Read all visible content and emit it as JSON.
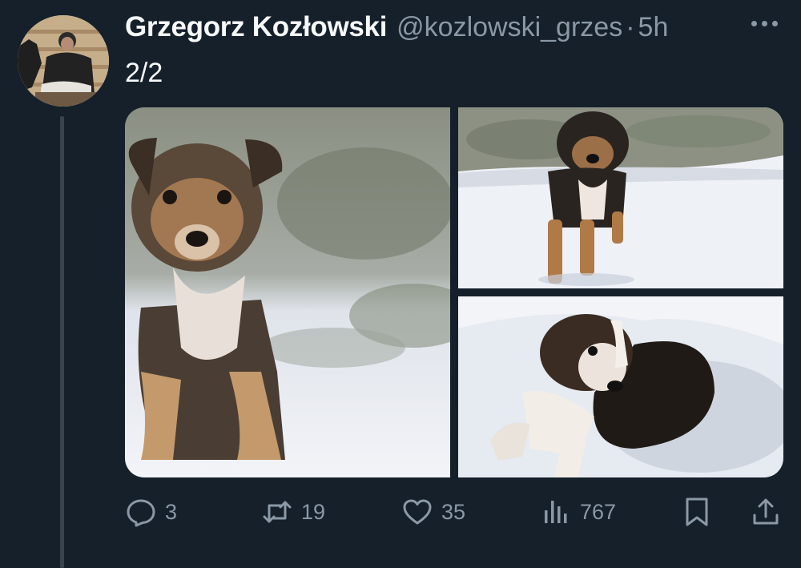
{
  "author": {
    "display_name": "Grzegorz Kozłowski",
    "handle": "@kozlowski_grzes",
    "separator": "·",
    "time": "5h"
  },
  "tweet": {
    "text": "2/2"
  },
  "media": {
    "photos": [
      {
        "subject": "puppy-sitting-in-snow"
      },
      {
        "subject": "puppy-standing-in-snow"
      },
      {
        "subject": "puppy-lying-in-snow"
      }
    ]
  },
  "actions": {
    "reply": {
      "icon": "reply-icon",
      "count": "3"
    },
    "retweet": {
      "icon": "retweet-icon",
      "count": "19"
    },
    "like": {
      "icon": "heart-icon",
      "count": "35"
    },
    "views": {
      "icon": "analytics-icon",
      "count": "767"
    },
    "bookmark": {
      "icon": "bookmark-icon"
    },
    "share": {
      "icon": "share-icon"
    }
  },
  "colors": {
    "background": "#15202b",
    "text_primary": "#f7f9f9",
    "text_secondary": "#8b98a5",
    "thread_line": "#38444d"
  }
}
